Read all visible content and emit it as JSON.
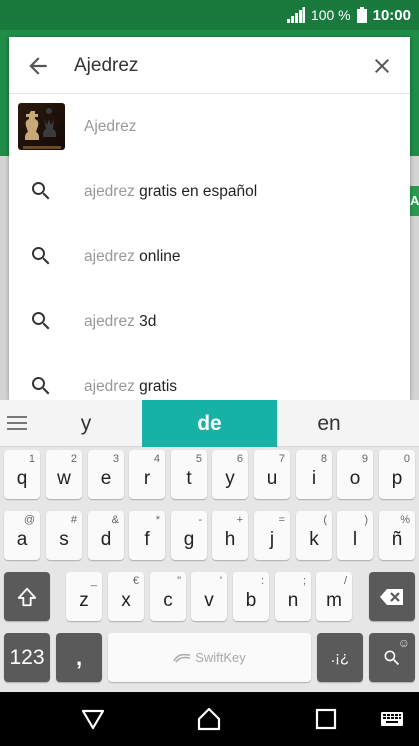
{
  "status_bar": {
    "battery_text": "100 %",
    "time": "10:00"
  },
  "search": {
    "query": "Ajedrez"
  },
  "suggestions": [
    {
      "prefix": "Ajedrez",
      "rest": "",
      "kind": "app"
    },
    {
      "prefix": "ajedrez",
      "rest": " gratis en español",
      "kind": "query"
    },
    {
      "prefix": "ajedrez",
      "rest": " online",
      "kind": "query"
    },
    {
      "prefix": "ajedrez",
      "rest": " 3d",
      "kind": "query"
    },
    {
      "prefix": "ajedrez",
      "rest": " gratis",
      "kind": "query"
    }
  ],
  "background": {
    "edge_button_label": "A"
  },
  "keyboard": {
    "predictions": {
      "left": "y",
      "middle": "de",
      "right": "en"
    },
    "row1": [
      {
        "key": "q",
        "hint": "1"
      },
      {
        "key": "w",
        "hint": "2"
      },
      {
        "key": "e",
        "hint": "3"
      },
      {
        "key": "r",
        "hint": "4"
      },
      {
        "key": "t",
        "hint": "5"
      },
      {
        "key": "y",
        "hint": "6"
      },
      {
        "key": "u",
        "hint": "7"
      },
      {
        "key": "i",
        "hint": "8"
      },
      {
        "key": "o",
        "hint": "9"
      },
      {
        "key": "p",
        "hint": "0"
      }
    ],
    "row2": [
      {
        "key": "a",
        "hint": "@"
      },
      {
        "key": "s",
        "hint": "#"
      },
      {
        "key": "d",
        "hint": "&"
      },
      {
        "key": "f",
        "hint": "*"
      },
      {
        "key": "g",
        "hint": "-"
      },
      {
        "key": "h",
        "hint": "+"
      },
      {
        "key": "j",
        "hint": "="
      },
      {
        "key": "k",
        "hint": "("
      },
      {
        "key": "l",
        "hint": ")"
      },
      {
        "key": "ñ",
        "hint": "%"
      }
    ],
    "row3": [
      {
        "key": "z",
        "hint": "_"
      },
      {
        "key": "x",
        "hint": "€"
      },
      {
        "key": "c",
        "hint": "\""
      },
      {
        "key": "v",
        "hint": "'"
      },
      {
        "key": "b",
        "hint": ":"
      },
      {
        "key": "n",
        "hint": ";"
      },
      {
        "key": "m",
        "hint": "/"
      }
    ],
    "numbers_key": "123",
    "comma_key": ",",
    "comma_hint": "",
    "space_brand": "SwiftKey",
    "punct_key": ".¡¿",
    "search_key_hint": "☺",
    "colors": {
      "accent": "#17b2a6",
      "dark_key": "#5a5a5a"
    }
  },
  "icons": {
    "back": "arrow-left-icon",
    "clear": "close-icon",
    "suggestion": "search-icon",
    "shift": "shift-icon",
    "backspace": "backspace-icon",
    "nav_back": "triangle-back-icon",
    "nav_home": "home-icon",
    "nav_recent": "square-recent-icon",
    "nav_keyboard": "keyboard-icon"
  },
  "colors": {
    "status_bar": "#1a7a3e",
    "app_bar": "#1f8c47"
  }
}
